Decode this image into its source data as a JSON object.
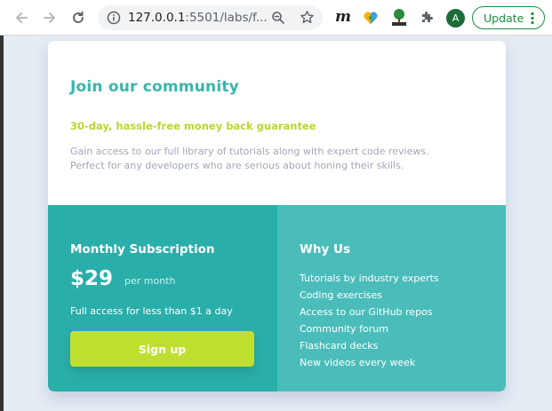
{
  "browser": {
    "url_host": "127.0.0.1",
    "url_rest": ":5501/labs/f...",
    "update_label": "Update",
    "avatar_letter": "A",
    "extension_m": "m",
    "accent_color": "#1e8e3e"
  },
  "card": {
    "heading": "Join our community",
    "guarantee": "30-day, hassle-free money back guarantee",
    "description": "Gain access to our full library of tutorials along with expert code reviews. Perfect for any developers who are serious about honing their skills."
  },
  "subscription": {
    "title": "Monthly Subscription",
    "price": "$29",
    "per_month": "per month",
    "access": "Full access for less than $1 a day",
    "signup_label": "Sign up"
  },
  "why": {
    "title": "Why Us",
    "items": [
      "Tutorials by industry experts",
      "Coding exercises",
      "Access to our GitHub repos",
      "Community forum",
      "Flashcard decks",
      "New videos every week"
    ]
  },
  "colors": {
    "heading": "#3ab5ac",
    "guarantee": "#bdd62c",
    "subscription_bg": "#2aaea9",
    "why_bg": "#4abdbb",
    "signup_bg": "#bfdf2f"
  }
}
